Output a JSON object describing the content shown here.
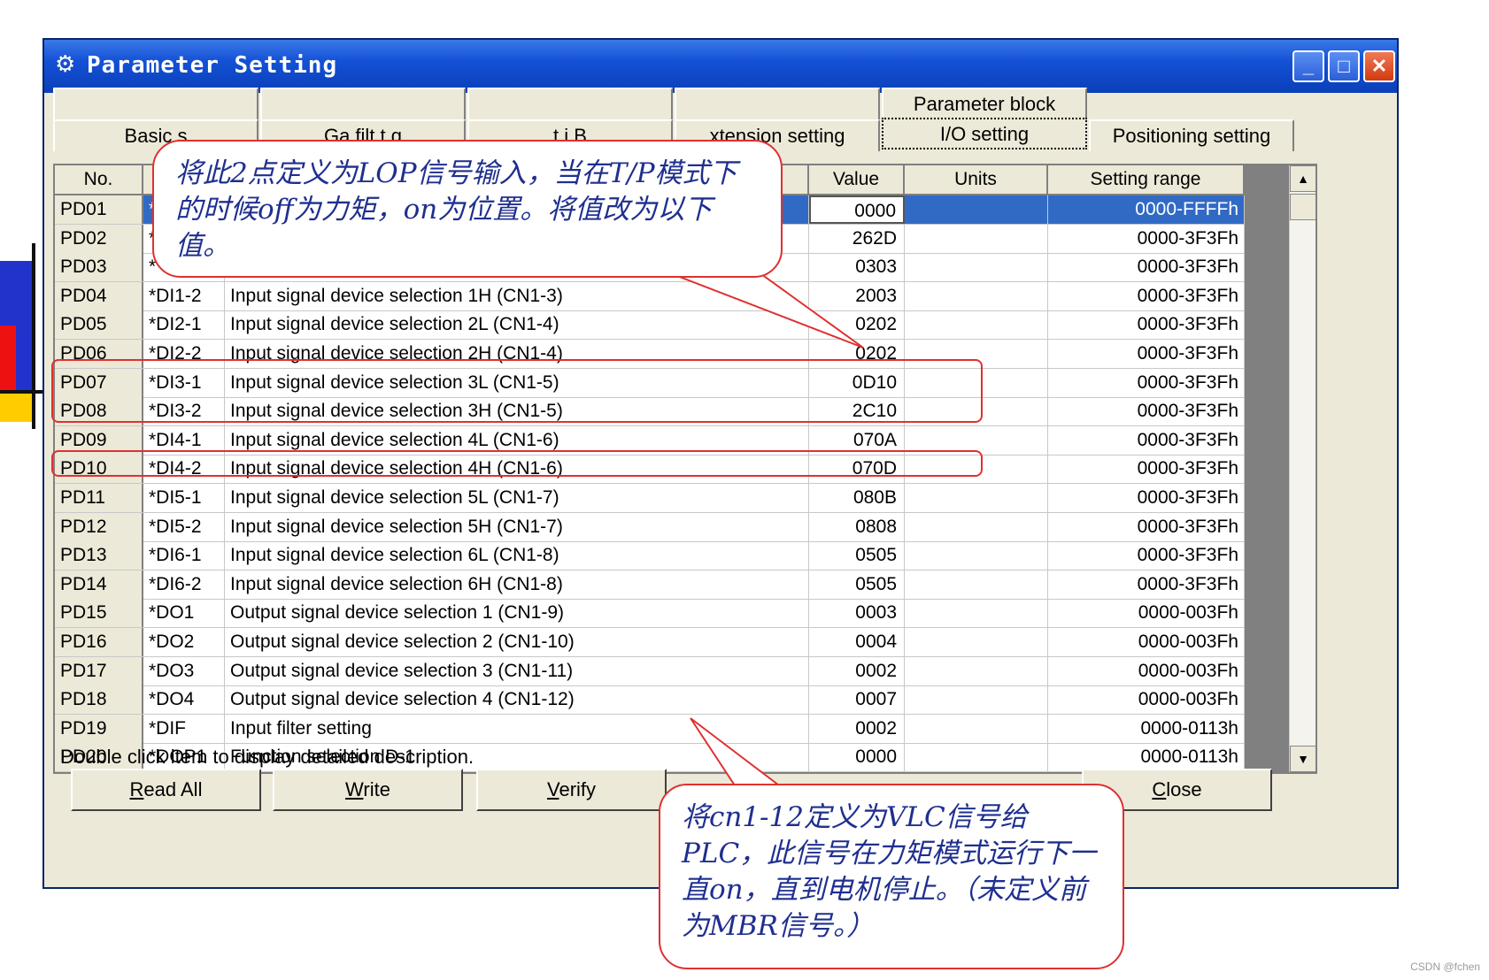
{
  "window": {
    "title": "Parameter Setting",
    "min": "_",
    "max": "□",
    "close": "✕"
  },
  "tabs_top": [
    "",
    "",
    "",
    "",
    "Parameter block"
  ],
  "tabs": [
    "Basic setting",
    "Gain/filter setting",
    "Extension setting 2",
    "Extension setting",
    "I/O setting",
    "Positioning setting"
  ],
  "tabs_visible": [
    "Basic s",
    "Ga  filt  t  g",
    "  t  i  B  ",
    "xtension setting",
    "I/O setting",
    "Positioning setting"
  ],
  "table": {
    "headers": [
      "No.",
      "",
      "",
      "Value",
      "Units",
      "Setting range"
    ],
    "rows": [
      {
        "no": "PD01",
        "abbr": "*",
        "name": "",
        "value": "0000",
        "units": "",
        "range": "0000-FFFFh"
      },
      {
        "no": "PD02",
        "abbr": "*",
        "name": "",
        "value": "262D",
        "units": "",
        "range": "0000-3F3Fh"
      },
      {
        "no": "PD03",
        "abbr": "*",
        "name": "",
        "value": "0303",
        "units": "",
        "range": "0000-3F3Fh"
      },
      {
        "no": "PD04",
        "abbr": "*DI1-2",
        "name": "Input signal device selection 1H (CN1-3)",
        "value": "2003",
        "units": "",
        "range": "0000-3F3Fh"
      },
      {
        "no": "PD05",
        "abbr": "*DI2-1",
        "name": "Input signal device selection 2L (CN1-4)",
        "value": "0202",
        "units": "",
        "range": "0000-3F3Fh"
      },
      {
        "no": "PD06",
        "abbr": "*DI2-2",
        "name": "Input signal device selection 2H (CN1-4)",
        "value": "0202",
        "units": "",
        "range": "0000-3F3Fh"
      },
      {
        "no": "PD07",
        "abbr": "*DI3-1",
        "name": "Input signal device selection 3L (CN1-5)",
        "value": "0D10",
        "units": "",
        "range": "0000-3F3Fh"
      },
      {
        "no": "PD08",
        "abbr": "*DI3-2",
        "name": "Input signal device selection 3H (CN1-5)",
        "value": "2C10",
        "units": "",
        "range": "0000-3F3Fh"
      },
      {
        "no": "PD09",
        "abbr": "*DI4-1",
        "name": "Input signal device selection 4L (CN1-6)",
        "value": "070A",
        "units": "",
        "range": "0000-3F3Fh"
      },
      {
        "no": "PD10",
        "abbr": "*DI4-2",
        "name": "Input signal device selection 4H (CN1-6)",
        "value": "070D",
        "units": "",
        "range": "0000-3F3Fh"
      },
      {
        "no": "PD11",
        "abbr": "*DI5-1",
        "name": "Input signal device selection 5L (CN1-7)",
        "value": "080B",
        "units": "",
        "range": "0000-3F3Fh"
      },
      {
        "no": "PD12",
        "abbr": "*DI5-2",
        "name": "Input signal device selection 5H (CN1-7)",
        "value": "0808",
        "units": "",
        "range": "0000-3F3Fh"
      },
      {
        "no": "PD13",
        "abbr": "*DI6-1",
        "name": "Input signal device selection 6L (CN1-8)",
        "value": "0505",
        "units": "",
        "range": "0000-3F3Fh"
      },
      {
        "no": "PD14",
        "abbr": "*DI6-2",
        "name": "Input signal device selection 6H (CN1-8)",
        "value": "0505",
        "units": "",
        "range": "0000-3F3Fh"
      },
      {
        "no": "PD15",
        "abbr": "*DO1",
        "name": "Output signal device selection 1 (CN1-9)",
        "value": "0003",
        "units": "",
        "range": "0000-003Fh"
      },
      {
        "no": "PD16",
        "abbr": "*DO2",
        "name": "Output signal device selection 2 (CN1-10)",
        "value": "0004",
        "units": "",
        "range": "0000-003Fh"
      },
      {
        "no": "PD17",
        "abbr": "*DO3",
        "name": "Output signal device selection 3 (CN1-11)",
        "value": "0002",
        "units": "",
        "range": "0000-003Fh"
      },
      {
        "no": "PD18",
        "abbr": "*DO4",
        "name": "Output signal device selection 4 (CN1-12)",
        "value": "0007",
        "units": "",
        "range": "0000-003Fh"
      },
      {
        "no": "PD19",
        "abbr": "*DIF",
        "name": "Input filter setting",
        "value": "0002",
        "units": "",
        "range": "0000-0113h"
      },
      {
        "no": "PD20",
        "abbr": "*DOP1",
        "name": "Function selection D-1",
        "value": "0000",
        "units": "",
        "range": "0000-0113h"
      }
    ]
  },
  "status_text": "Double click item to display detailed description.",
  "buttons": {
    "read_all": {
      "key": "R",
      "rest": "ead All"
    },
    "write": {
      "key": "W",
      "rest": "rite"
    },
    "verify": {
      "key": "V",
      "rest": "erify"
    },
    "close": {
      "key": "C",
      "rest": "lose"
    }
  },
  "callouts": {
    "top": "将此2点定义为LOP信号输入，当在T/P模式下的时候off为力矩，on为位置。将值改为以下值。",
    "bottom": "将cn1-12定义为VLC信号给PLC，此信号在力矩模式运行下一直on，直到电机停止。（未定义前为MBR信号。）"
  },
  "watermark": "CSDN @fchen",
  "colors": {
    "selection": "#316ac5",
    "callout_border": "#e03030",
    "callout_text": "#1f2f8f",
    "titlebar": "#1451d6"
  },
  "icons": {
    "title": "gear-icon",
    "scroll_up": "arrow-up-icon",
    "scroll_down": "arrow-down-icon"
  }
}
